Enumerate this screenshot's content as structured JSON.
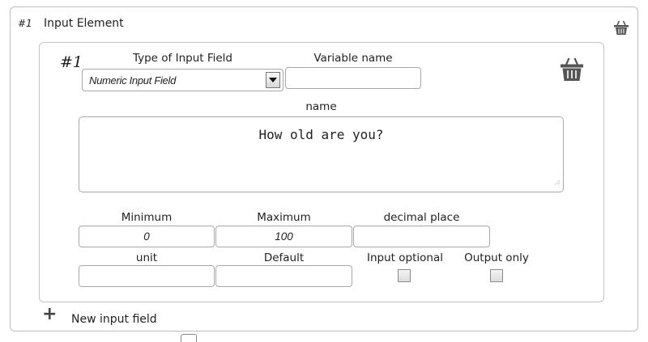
{
  "outer": {
    "index": "#1",
    "title": "Input Element"
  },
  "inner": {
    "index": "#1",
    "type_label": "Type of Input Field",
    "type_value": "Numeric Input Field",
    "variable_label": "Variable name",
    "variable_value": "",
    "name_label": "name",
    "name_value": "How old are you?",
    "minimum_label": "Minimum",
    "minimum_value": "0",
    "maximum_label": "Maximum",
    "maximum_value": "100",
    "decimal_label": "decimal place",
    "decimal_value": "",
    "unit_label": "unit",
    "unit_value": "",
    "default_label": "Default",
    "default_value": "",
    "optional_label": "Input optional",
    "optional_checked": false,
    "output_label": "Output only",
    "output_checked": false
  },
  "new_field_label": "New input field",
  "icons": {
    "delete": "basket-icon",
    "add": "plus-icon",
    "dropdown": "triangle-down-icon",
    "resize": "resize-grip-icon"
  },
  "colors": {
    "border": "#a8a8a8",
    "icon": "#555555"
  }
}
